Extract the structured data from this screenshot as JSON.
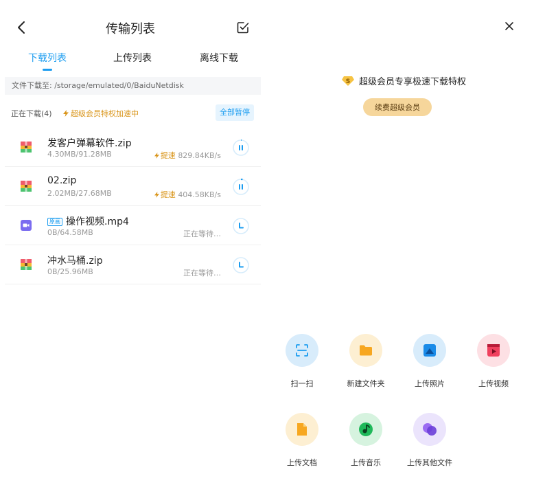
{
  "left_panel": {
    "header": {
      "title": "传输列表"
    },
    "tabs": [
      {
        "label": "下载列表",
        "active": true
      },
      {
        "label": "上传列表",
        "active": false
      },
      {
        "label": "离线下载",
        "active": false
      }
    ],
    "path_label": "文件下载至: /storage/emulated/0/BaiduNetdisk",
    "downloading": {
      "count_label": "正在下载(4)",
      "vip_label": "超级会员特权加速中",
      "pause_all_label": "全部暂停"
    },
    "files": [
      {
        "name": "发客户弹幕软件.zip",
        "size": "4.30MB/91.28MB",
        "boost": "提速",
        "speed": "829.84KB/s",
        "status": ""
      },
      {
        "name": "02.zip",
        "size": "2.02MB/27.68MB",
        "boost": "提速",
        "speed": "404.58KB/s",
        "status": ""
      },
      {
        "name": "操作视频.mp4",
        "badge": "原画",
        "size": "0B/64.58MB",
        "boost": "",
        "speed": "",
        "status": "正在等待…"
      },
      {
        "name": "冲水马桶.zip",
        "size": "0B/25.96MB",
        "boost": "",
        "speed": "",
        "status": "正在等待…"
      }
    ]
  },
  "right_panel": {
    "promo_text": "超级会员专享极速下载特权",
    "vip_badge_text": "S",
    "renew_label": "续费超级会员",
    "actions": [
      {
        "label": "扫一扫",
        "icon": "scan-icon"
      },
      {
        "label": "新建文件夹",
        "icon": "folder-icon"
      },
      {
        "label": "上传照片",
        "icon": "photo-icon"
      },
      {
        "label": "上传视频",
        "icon": "video-icon"
      },
      {
        "label": "上传文档",
        "icon": "document-icon"
      },
      {
        "label": "上传音乐",
        "icon": "music-icon"
      },
      {
        "label": "上传其他文件",
        "icon": "other-files-icon"
      }
    ]
  },
  "colors": {
    "accent": "#1a9cf0",
    "vip_gold": "#d99418",
    "renew_button": "#f6d69b"
  }
}
